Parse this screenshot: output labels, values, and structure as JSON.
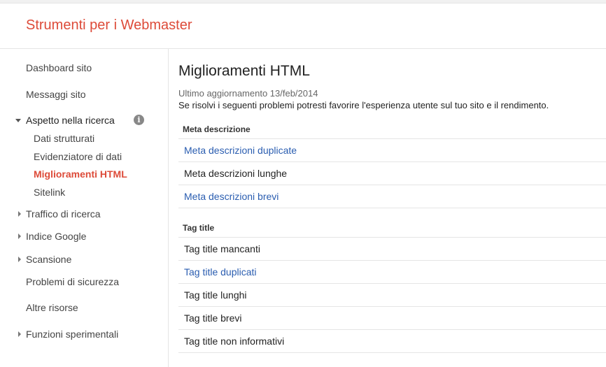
{
  "header": {
    "title": "Strumenti per i Webmaster"
  },
  "sidebar": {
    "items": [
      {
        "label": "Dashboard sito"
      },
      {
        "label": "Messaggi sito"
      },
      {
        "label": "Aspetto nella ricerca",
        "info_icon": "i"
      },
      {
        "label": "Dati strutturati"
      },
      {
        "label": "Evidenziatore di dati"
      },
      {
        "label": "Miglioramenti HTML",
        "active": true
      },
      {
        "label": "Sitelink"
      },
      {
        "label": "Traffico di ricerca"
      },
      {
        "label": "Indice Google"
      },
      {
        "label": "Scansione"
      },
      {
        "label": "Problemi di sicurezza"
      },
      {
        "label": "Altre risorse"
      },
      {
        "label": "Funzioni sperimentali"
      }
    ]
  },
  "main": {
    "title": "Miglioramenti HTML",
    "updated": "Ultimo aggiornamento 13/feb/2014",
    "description": "Se risolvi i seguenti problemi potresti favorire l'esperienza utente sul tuo sito e il rendimento.",
    "sections": [
      {
        "header": "Meta descrizione",
        "rows": [
          {
            "label": "Meta descrizioni duplicate",
            "link": true
          },
          {
            "label": "Meta descrizioni lunghe",
            "link": false
          },
          {
            "label": "Meta descrizioni brevi",
            "link": true
          }
        ]
      },
      {
        "header": "Tag title",
        "rows": [
          {
            "label": "Tag title mancanti",
            "link": false
          },
          {
            "label": "Tag title duplicati",
            "link": true
          },
          {
            "label": "Tag title lunghi",
            "link": false
          },
          {
            "label": "Tag title brevi",
            "link": false
          },
          {
            "label": "Tag title non informativi",
            "link": false
          }
        ]
      }
    ]
  },
  "colors": {
    "brand": "#dd4b39",
    "link": "#2a5db0",
    "border": "#e5e5e5",
    "text": "#222222"
  }
}
